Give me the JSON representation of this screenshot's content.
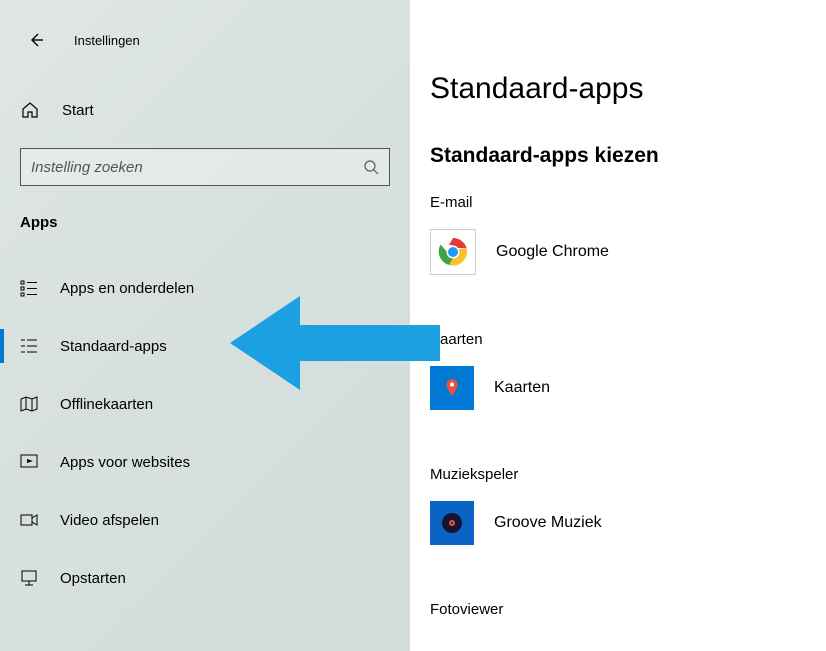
{
  "window": {
    "title": "Instellingen"
  },
  "sidebar": {
    "home_label": "Start",
    "search_placeholder": "Instelling zoeken",
    "section_label": "Apps",
    "items": [
      {
        "label": "Apps en onderdelen"
      },
      {
        "label": "Standaard-apps"
      },
      {
        "label": "Offlinekaarten"
      },
      {
        "label": "Apps voor websites"
      },
      {
        "label": "Video afspelen"
      },
      {
        "label": "Opstarten"
      }
    ]
  },
  "main": {
    "heading": "Standaard-apps",
    "subheading": "Standaard-apps kiezen",
    "categories": [
      {
        "label": "E-mail",
        "app": "Google Chrome"
      },
      {
        "label": "Kaarten",
        "app": "Kaarten"
      },
      {
        "label": "Muziekspeler",
        "app": "Groove Muziek"
      },
      {
        "label": "Fotoviewer",
        "app": ""
      }
    ]
  },
  "annotation": {
    "arrow_color": "#1ba0e1"
  }
}
